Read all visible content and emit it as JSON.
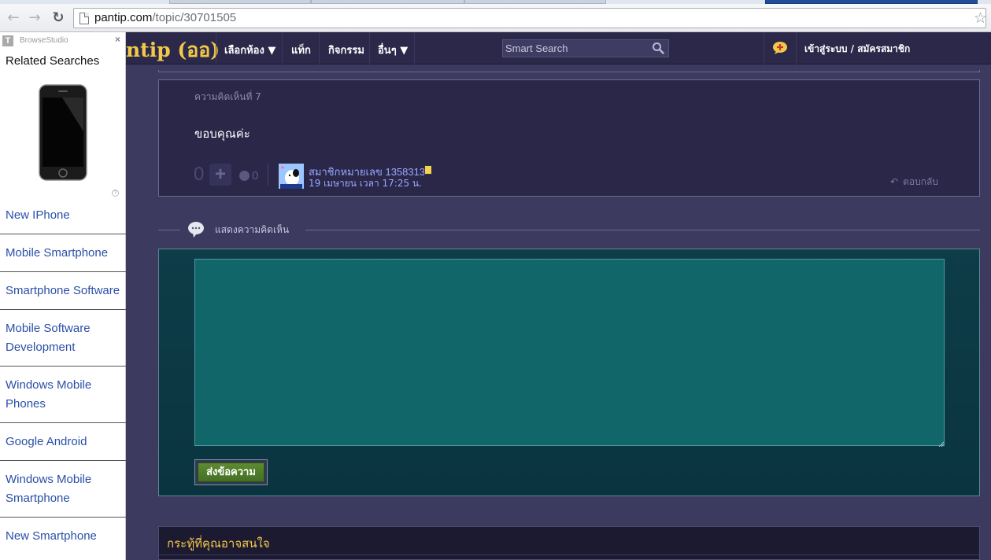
{
  "browser": {
    "url_host": "pantip.com",
    "url_path": "/topic/30701505"
  },
  "site_header": {
    "logo_text": "ntip (ออ)",
    "menu": [
      "เลือกห้อง ▼",
      "แท็ก",
      "กิจกรรม",
      "อื่นๆ ▼"
    ],
    "search_placeholder": "Smart Search",
    "login_link": "เข้าสู่ระบบ / สมัครสมาชิก"
  },
  "sidebar": {
    "brand": "BrowseStudio",
    "close": "×",
    "title": "Related Searches",
    "items": [
      {
        "label": "New IPhone"
      },
      {
        "label": "Mobile Smartphone"
      },
      {
        "label": "Smartphone Software"
      },
      {
        "label": "Mobile Software Development"
      },
      {
        "label": "Windows Mobile Phones"
      },
      {
        "label": "Google Android"
      },
      {
        "label": "Windows Mobile Smartphone"
      },
      {
        "label": "New Smartphone"
      }
    ]
  },
  "comment": {
    "number_label": "ความคิดเห็นที่ 7",
    "body": "ขอบคุณค่ะ",
    "votes": "0",
    "emotion_count": "0",
    "username": "สมาชิกหมายเลข 1358313",
    "date": "19 เมษายน เวลา 17:25 น.",
    "reply_label": "ตอบกลับ"
  },
  "reply_section": {
    "title": "แสดงความคิดเห็น",
    "textarea_value": "",
    "submit_label": "ส่งข้อความ"
  },
  "related_topics": {
    "title": "กระทู้ที่คุณอาจสนใจ"
  },
  "colors": {
    "header_bg": "#2b2849",
    "page_bg": "#3c3a5e",
    "logo_yellow": "#f3c94a",
    "link_blue": "#2a4fa8",
    "reply_panel_bg": "#0d3d48",
    "submit_green": "#4f7d2a"
  }
}
